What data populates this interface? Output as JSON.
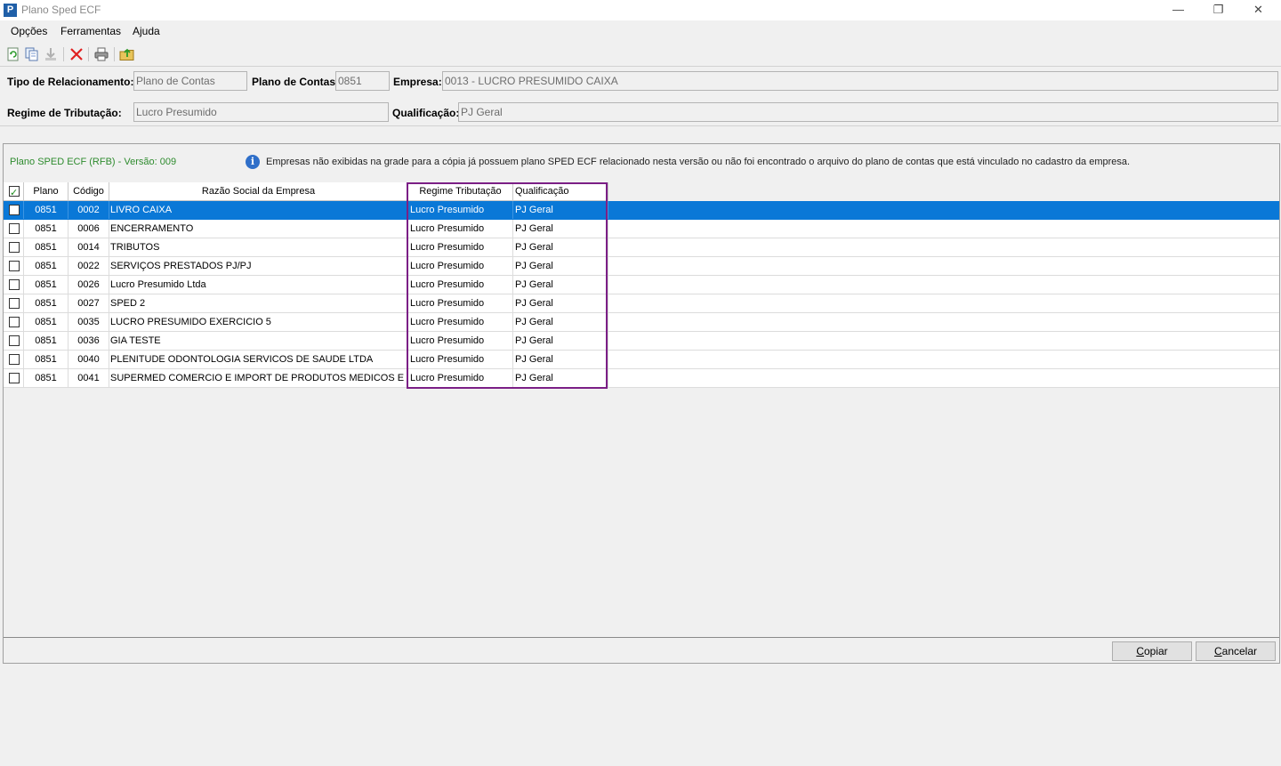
{
  "window": {
    "title": "Plano Sped ECF",
    "app_icon_letter": "P",
    "minimize_glyph": "—",
    "restore_glyph": "❐",
    "close_glyph": "✕"
  },
  "menu": {
    "items": [
      {
        "label": "Opções"
      },
      {
        "label": "Ferramentas"
      },
      {
        "label": "Ajuda"
      }
    ]
  },
  "toolbar": {
    "icons": [
      "refresh-icon",
      "copy-icon",
      "download-icon",
      "delete-icon",
      "print-icon",
      "export-folder-icon"
    ]
  },
  "form": {
    "tipo_label": "Tipo de Relacionamento:",
    "tipo_value": "Plano de Contas",
    "plano_label": "Plano de Contas:",
    "plano_value": "0851",
    "empresa_label": "Empresa:",
    "empresa_value": "0013 - LUCRO PRESUMIDO CAIXA",
    "regime_label": "Regime de Tributação:",
    "regime_value": "Lucro Presumido",
    "qualificacao_label": "Qualificação:",
    "qualificacao_value": "PJ Geral"
  },
  "panel": {
    "plan_version": "Plano SPED ECF (RFB) - Versão: 009",
    "info_icon_glyph": "i",
    "info_message": "Empresas não exibidas na grade para a cópia já possuem plano SPED ECF relacionado nesta versão ou não foi encontrado o arquivo do plano de contas que está vinculado no cadastro da empresa."
  },
  "grid": {
    "header_checked": true,
    "columns": {
      "plano": "Plano",
      "codigo": "Código",
      "razao": "Razão Social da Empresa",
      "regime": "Regime Tributação",
      "qualificacao": "Qualificação"
    },
    "rows": [
      {
        "plano": "0851",
        "codigo": "0002",
        "razao": "LIVRO CAIXA",
        "regime": "Lucro Presumido",
        "qualificacao": "PJ Geral",
        "selected": true,
        "checked": false
      },
      {
        "plano": "0851",
        "codigo": "0006",
        "razao": "ENCERRAMENTO",
        "regime": "Lucro Presumido",
        "qualificacao": "PJ Geral",
        "selected": false,
        "checked": false
      },
      {
        "plano": "0851",
        "codigo": "0014",
        "razao": "TRIBUTOS",
        "regime": "Lucro Presumido",
        "qualificacao": "PJ Geral",
        "selected": false,
        "checked": false
      },
      {
        "plano": "0851",
        "codigo": "0022",
        "razao": "SERVIÇOS PRESTADOS PJ/PJ",
        "regime": "Lucro Presumido",
        "qualificacao": "PJ Geral",
        "selected": false,
        "checked": false
      },
      {
        "plano": "0851",
        "codigo": "0026",
        "razao": "Lucro Presumido Ltda",
        "regime": "Lucro Presumido",
        "qualificacao": "PJ Geral",
        "selected": false,
        "checked": false
      },
      {
        "plano": "0851",
        "codigo": "0027",
        "razao": "SPED 2",
        "regime": "Lucro Presumido",
        "qualificacao": "PJ Geral",
        "selected": false,
        "checked": false
      },
      {
        "plano": "0851",
        "codigo": "0035",
        "razao": "LUCRO PRESUMIDO EXERCICIO 5",
        "regime": "Lucro Presumido",
        "qualificacao": "PJ Geral",
        "selected": false,
        "checked": false
      },
      {
        "plano": "0851",
        "codigo": "0036",
        "razao": "GIA TESTE",
        "regime": "Lucro Presumido",
        "qualificacao": "PJ Geral",
        "selected": false,
        "checked": false
      },
      {
        "plano": "0851",
        "codigo": "0040",
        "razao": "PLENITUDE ODONTOLOGIA SERVICOS DE SAUDE LTDA",
        "regime": "Lucro Presumido",
        "qualificacao": "PJ Geral",
        "selected": false,
        "checked": false
      },
      {
        "plano": "0851",
        "codigo": "0041",
        "razao": "SUPERMED COMERCIO E IMPORT DE PRODUTOS MEDICOS E HOSP LTDA",
        "regime": "Lucro Presumido",
        "qualificacao": "PJ Geral",
        "selected": false,
        "checked": false
      }
    ]
  },
  "buttons": {
    "copiar_first": "C",
    "copiar_rest": "opiar",
    "cancelar_first": "C",
    "cancelar_rest": "ancelar"
  },
  "colors": {
    "selection": "#0a78d7",
    "highlight_border": "#7b1f86",
    "plan_version_text": "#2e8b2e"
  }
}
